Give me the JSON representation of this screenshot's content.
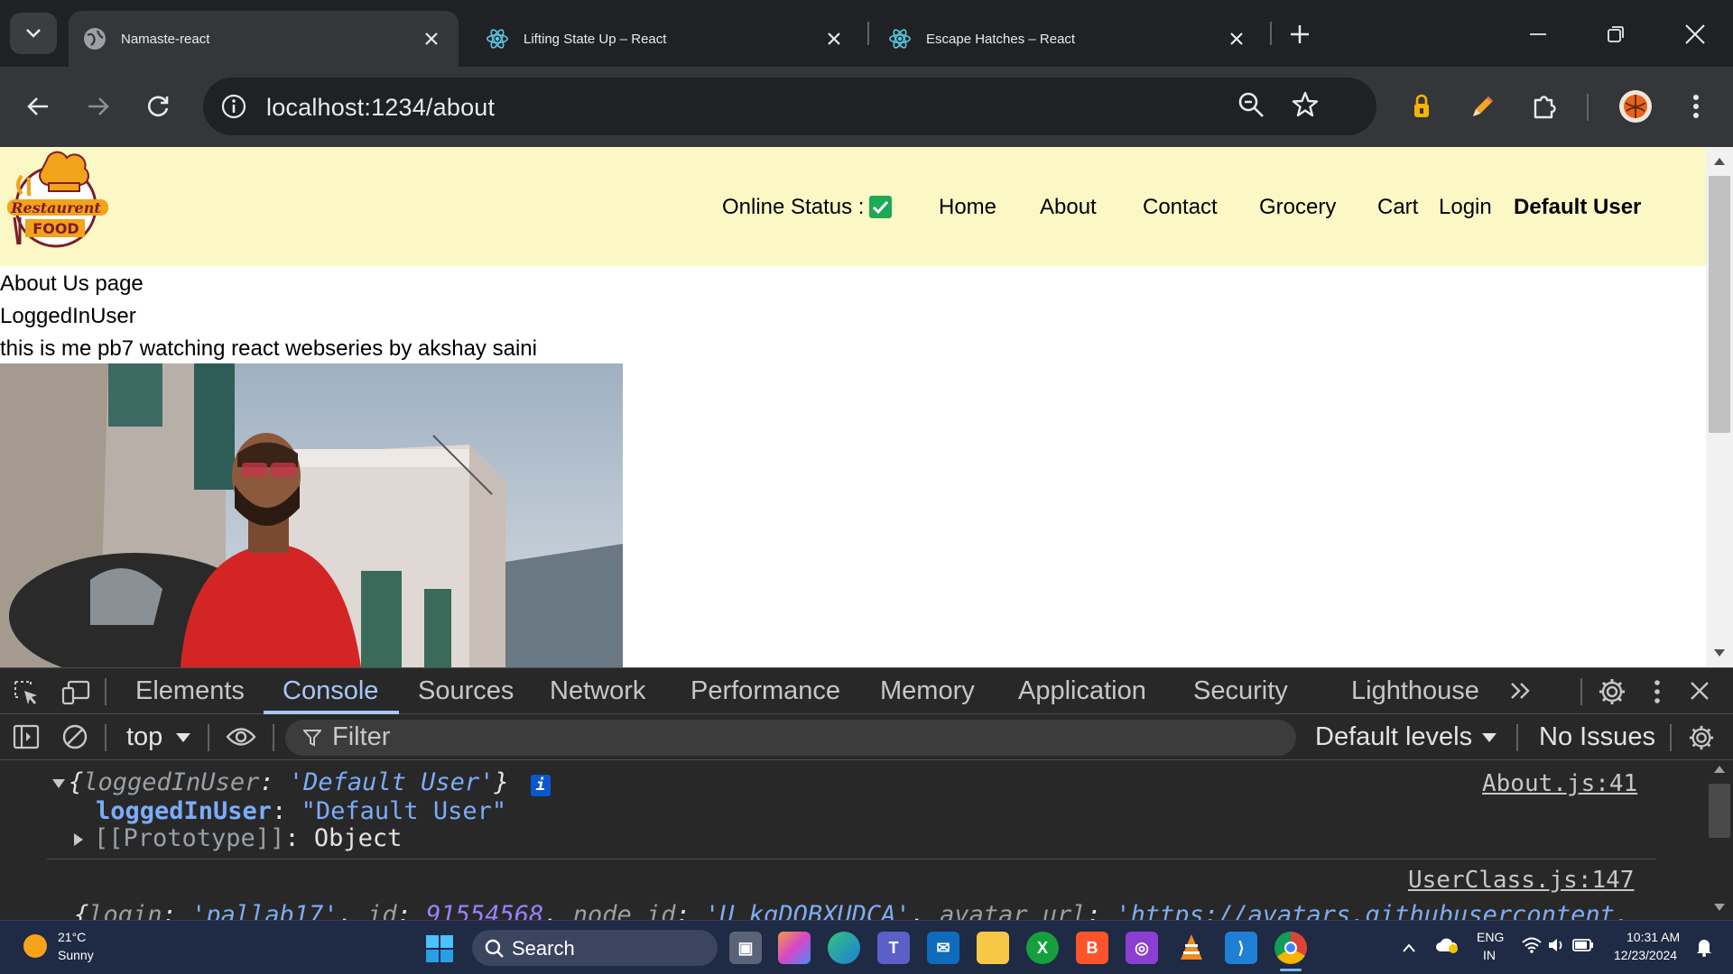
{
  "browser": {
    "tabs": [
      {
        "title": "Namaste-react",
        "active": true,
        "icon": "globe-icon"
      },
      {
        "title": "Lifting State Up – React",
        "active": false,
        "icon": "react-icon"
      },
      {
        "title": "Escape Hatches – React",
        "active": false,
        "icon": "react-icon"
      }
    ],
    "url": "localhost:1234/about"
  },
  "page": {
    "logo": {
      "line1": "Restaurent",
      "line2": "FOOD"
    },
    "nav": {
      "online_status": "Online Status :",
      "home": "Home",
      "about": "About",
      "contact": "Contact",
      "grocery": "Grocery",
      "cart": "Cart",
      "login": "Login",
      "user": "Default User"
    },
    "content": {
      "heading": "About Us page",
      "logged_in": "LoggedInUser",
      "description": "this is me pb7 watching react webseries by akshay saini"
    }
  },
  "devtools": {
    "tabs": [
      "Elements",
      "Console",
      "Sources",
      "Network",
      "Performance",
      "Memory",
      "Application",
      "Security",
      "Lighthouse"
    ],
    "active_tab": "Console",
    "context": "top",
    "filter_placeholder": "Filter",
    "levels": "Default levels",
    "issues": "No Issues",
    "console": {
      "entry1": {
        "summary_key": "loggedInUser",
        "summary_value": "'Default User'",
        "prop_key": "loggedInUser",
        "prop_value": "\"Default User\"",
        "proto_key": "[[Prototype]]",
        "proto_value": "Object",
        "source": "About.js:41"
      },
      "entry2": {
        "source": "UserClass.js:147",
        "login_key": "login",
        "login_value": "'pallab17'",
        "id_key": "id",
        "id_value": "91554568",
        "node_key": "node_id",
        "node_value": "'U_kgDOBXUDCA'",
        "avatar_key": "avatar_url",
        "avatar_value": "'https://avatars.githubusercontent."
      }
    }
  },
  "taskbar": {
    "weather_temp": "21°C",
    "weather_desc": "Sunny",
    "search": "Search",
    "lang1": "ENG",
    "lang2": "IN",
    "time": "10:31 AM",
    "date": "12/23/2024"
  }
}
